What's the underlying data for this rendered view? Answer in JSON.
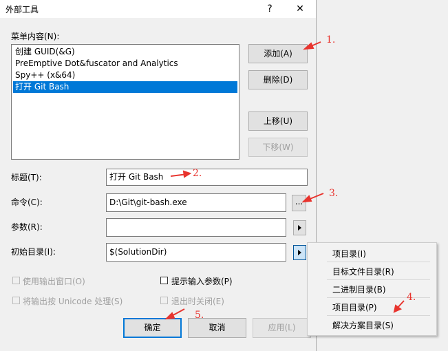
{
  "dialog": {
    "title": "外部工具",
    "help_glyph": "?",
    "close_glyph": "✕"
  },
  "menu_contents": {
    "label": "菜单内容(N):",
    "items": [
      "创建 GUID(&G)",
      "PreEmptive Dot&fuscator and Analytics",
      "Spy++ (x&64)",
      "打开 Git Bash"
    ],
    "selected_index": 3
  },
  "buttons": {
    "add": "添加(A)",
    "delete": "删除(D)",
    "move_up": "上移(U)",
    "move_down": "下移(W)",
    "ok": "确定",
    "cancel": "取消",
    "apply": "应用(L)",
    "browse": "..."
  },
  "fields": {
    "title_label": "标题(T):",
    "title_value": "打开 Git Bash",
    "command_label": "命令(C):",
    "command_value": "D:\\Git\\git-bash.exe",
    "args_label": "参数(R):",
    "args_value": "",
    "initdir_label": "初始目录(I):",
    "initdir_value": "$(SolutionDir)"
  },
  "checkboxes": {
    "use_output": {
      "label": "使用输出窗口(O)",
      "checked": false,
      "enabled": false
    },
    "prompt_args": {
      "label": "提示输入参数(P)",
      "checked": false,
      "enabled": true
    },
    "unicode": {
      "label": "将输出按 Unicode 处理(S)",
      "checked": false,
      "enabled": false
    },
    "close_on_exit": {
      "label": "退出时关闭(E)",
      "checked": false,
      "enabled": false
    }
  },
  "dir_menu": {
    "items": [
      "项目录(I)",
      "目标文件目录(R)",
      "二进制目录(B)",
      "项目目录(P)",
      "解决方案目录(S)"
    ]
  },
  "annotations": {
    "a1": "1.",
    "a2": "2.",
    "a3": "3.",
    "a4": "4.",
    "a5": "5.",
    "color": "#e8342e"
  }
}
